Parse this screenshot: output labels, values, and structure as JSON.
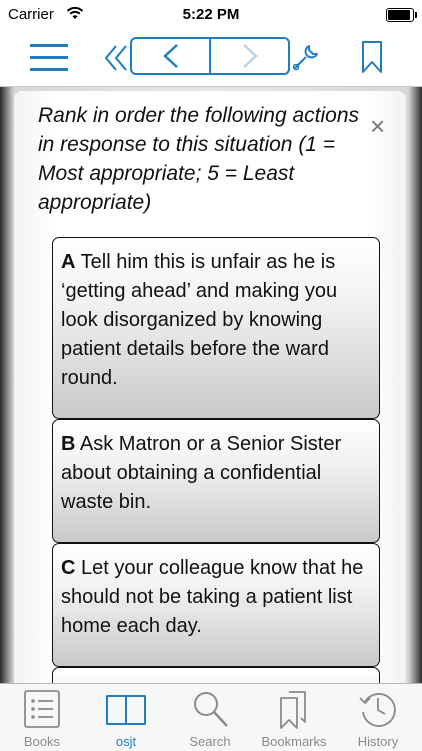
{
  "status_bar": {
    "carrier": "Carrier",
    "time": "5:22 PM"
  },
  "colors": {
    "accent": "#1e7ec2",
    "tab_inactive": "#8a8a8a"
  },
  "nav": {
    "icons": [
      "menu-icon",
      "rewind-icon",
      "back-icon",
      "forward-icon",
      "wrench-icon",
      "bookmark-icon"
    ]
  },
  "question": {
    "prompt": "Rank in order the following actions in response to this situation (1 = Most appropriate; 5 = Least appropriate)",
    "close_symbol": "×"
  },
  "options": [
    {
      "letter": "A",
      "text": "Tell him this is unfair as he is ‘getting ahead’ and making you look disorganized by knowing patient details before the ward round."
    },
    {
      "letter": "B",
      "text": "Ask Matron or a Senior Sister about obtaining a confidential waste bin."
    },
    {
      "letter": "C",
      "text": "Let your colleague know that he should not be taking a patient list home each day."
    },
    {
      "letter": "",
      "text": ""
    }
  ],
  "tabs": [
    {
      "label": "Books",
      "icon": "list-icon",
      "active": false
    },
    {
      "label": "osjt",
      "icon": "book-icon",
      "active": true
    },
    {
      "label": "Search",
      "icon": "search-icon",
      "active": false
    },
    {
      "label": "Bookmarks",
      "icon": "bookmarks-icon",
      "active": false
    },
    {
      "label": "History",
      "icon": "history-icon",
      "active": false
    }
  ]
}
